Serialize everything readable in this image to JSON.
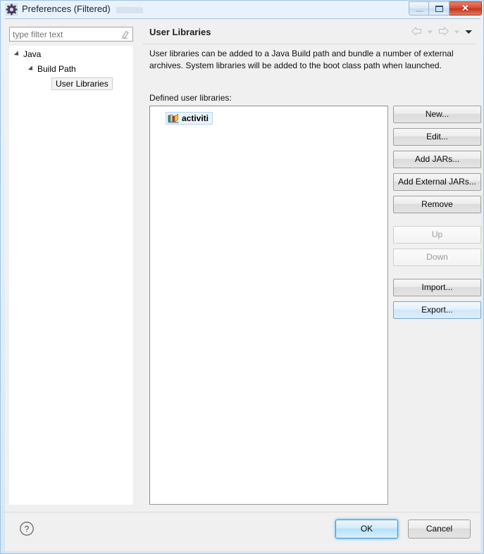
{
  "window": {
    "title": "Preferences (Filtered)",
    "icon": "gear-icon",
    "buttons": {
      "minimize": "minimize-icon",
      "maximize": "maximize-icon",
      "close": "✕"
    }
  },
  "sidebar": {
    "filter": {
      "placeholder": "type filter text",
      "value": "",
      "clear_icon": "eraser-icon"
    },
    "tree": [
      {
        "label": "Java",
        "level": 0,
        "expanded": true,
        "selected": false
      },
      {
        "label": "Build Path",
        "level": 1,
        "expanded": true,
        "selected": false
      },
      {
        "label": "User Libraries",
        "level": 2,
        "expanded": false,
        "selected": true
      }
    ]
  },
  "page": {
    "title": "User Libraries",
    "nav": {
      "back_icon": "back-arrow-icon",
      "back_dropdown_icon": "chevron-down-icon",
      "forward_icon": "forward-arrow-icon",
      "forward_dropdown_icon": "chevron-down-icon",
      "menu_icon": "chevron-down-icon"
    },
    "description": "User libraries can be added to a Java Build path and bundle a number of external archives. System libraries will be added to the boot class path when launched.",
    "list_label": "Defined user libraries:",
    "libraries": [
      {
        "name": "activiti",
        "icon": "library-books-icon",
        "selected": true
      }
    ],
    "actions": [
      {
        "label": "New...",
        "state": "enabled"
      },
      {
        "label": "Edit...",
        "state": "enabled"
      },
      {
        "label": "Add JARs...",
        "state": "enabled"
      },
      {
        "label": "Add External JARs...",
        "state": "enabled"
      },
      {
        "label": "Remove",
        "state": "enabled"
      },
      {
        "label": "Up",
        "state": "disabled"
      },
      {
        "label": "Down",
        "state": "disabled"
      },
      {
        "label": "Import...",
        "state": "enabled"
      },
      {
        "label": "Export...",
        "state": "hover"
      }
    ]
  },
  "footer": {
    "help_icon": "help-question-icon",
    "ok_label": "OK",
    "cancel_label": "Cancel"
  },
  "colors": {
    "title_text": "#10243b",
    "close_button": "#d9472c",
    "default_button_border": "#3c94d4",
    "selection_bg": "#e9f3fd",
    "frame_border": "#9dc4e4"
  }
}
